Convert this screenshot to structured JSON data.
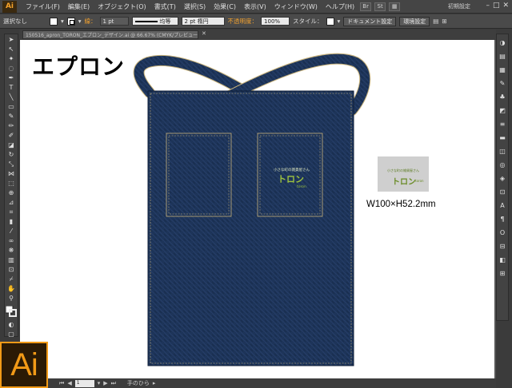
{
  "app": {
    "logo": "Ai",
    "workspace": "初期設定"
  },
  "menu": [
    "ファイル(F)",
    "編集(E)",
    "オブジェクト(O)",
    "書式(T)",
    "選択(S)",
    "効果(C)",
    "表示(V)",
    "ウィンドウ(W)",
    "ヘルプ(H)"
  ],
  "menubar_icons": [
    "Br",
    "St"
  ],
  "control": {
    "selection": "選択なし",
    "stroke_label": "線：",
    "stroke_weight": "1 pt",
    "stroke_profile": "均等",
    "brush": "2 pt 楕円",
    "opacity_label": "不透明度：",
    "opacity_value": "100%",
    "style_label": "スタイル：",
    "doc_setup": "ドキュメント設定",
    "preferences": "環境設定"
  },
  "document": {
    "tab_title": "150516_apron_TORON_エプロン_デザイン.ai @ 66.67% (CMYK/プレビュー)"
  },
  "artboard": {
    "title": "エプロン",
    "size_label": "W100×H52.2mm",
    "logo": {
      "small": "小さな町の雑貨屋さん",
      "big": "トロン",
      "sub": "toron"
    }
  },
  "status": {
    "page": "1",
    "tool": "手のひら"
  },
  "colors": {
    "denim": "#1d3459",
    "stitch": "#c8b27a",
    "ui_bg": "#3b3b3b",
    "accent": "#f29a17"
  }
}
